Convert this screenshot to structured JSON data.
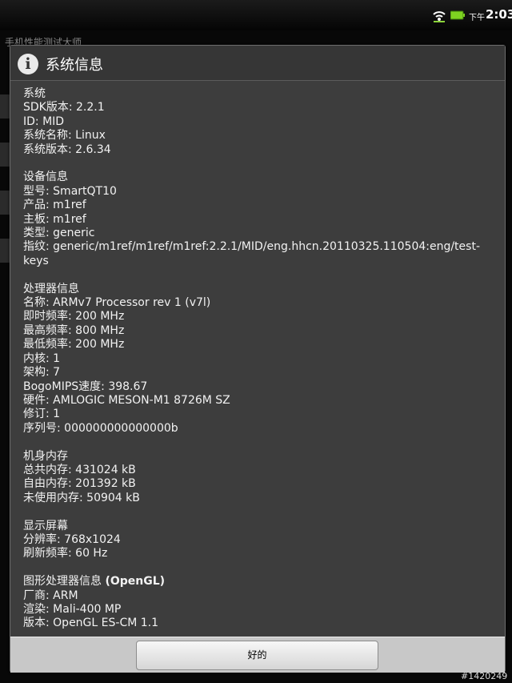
{
  "status_bar": {
    "ampm": "下午",
    "time": "2:03",
    "wifi_icon": "wifi-icon",
    "battery_icon": "battery-icon"
  },
  "background_app": {
    "title": "手机性能测试大师"
  },
  "dialog": {
    "icon": "info-icon",
    "title": "系统信息",
    "sections": [
      {
        "heading": "系统",
        "lines": [
          "SDK版本: 2.2.1",
          "ID: MID",
          "系统名称: Linux",
          "系统版本: 2.6.34"
        ]
      },
      {
        "heading": "设备信息",
        "lines": [
          "型号: SmartQT10",
          "产品: m1ref",
          "主板: m1ref",
          "类型: generic",
          "指纹: generic/m1ref/m1ref/m1ref:2.2.1/MID/eng.hhcn.20110325.110504:eng/test-keys"
        ]
      },
      {
        "heading": "处理器信息",
        "lines": [
          "名称: ARMv7 Processor rev 1 (v7l)",
          "即时频率: 200 MHz",
          "最高频率: 800 MHz",
          "最低频率: 200 MHz",
          "内核: 1",
          "架构: 7",
          "BogoMIPS速度: 398.67",
          "硬件: AMLOGIC MESON-M1 8726M SZ",
          "修订: 1",
          "序列号: 000000000000000b"
        ]
      },
      {
        "heading": "机身内存",
        "lines": [
          "总共内存: 431024 kB",
          "自由内存: 201392 kB",
          "未使用内存: 50904 kB"
        ]
      },
      {
        "heading": "显示屏幕",
        "lines": [
          "分辨率: 768x1024",
          "刷新频率: 60 Hz"
        ]
      },
      {
        "heading": "图形处理器信息",
        "heading_suffix": "(OpenGL)",
        "lines": [
          "厂商: ARM",
          "渲染: Mali-400 MP",
          "版本: OpenGL ES-CM 1.1"
        ]
      }
    ],
    "ok_label": "好的"
  },
  "watermark": "#1420249"
}
